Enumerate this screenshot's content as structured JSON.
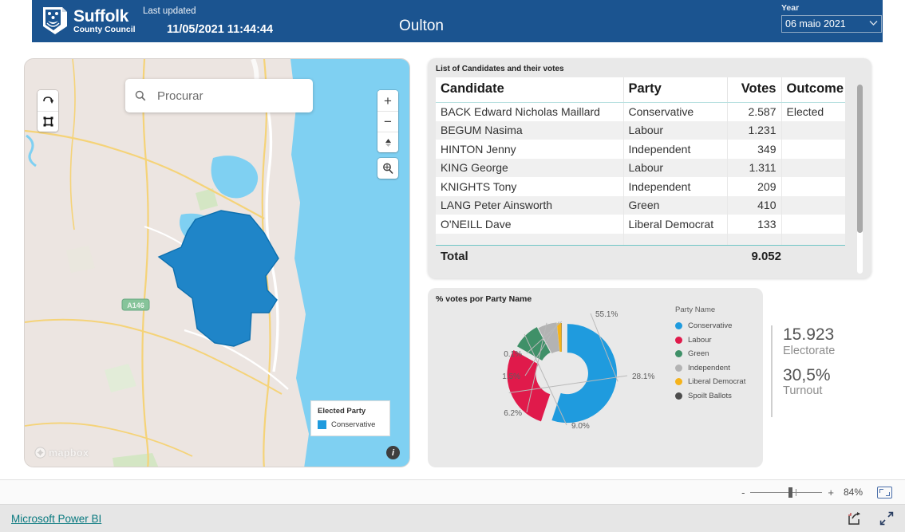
{
  "header": {
    "logo": {
      "icon": "suffolk-crest-icon",
      "line1": "Suffolk",
      "line2": "County Council"
    },
    "last_updated_label": "Last updated",
    "last_updated_value": "11/05/2021 11:44:44",
    "title": "Oulton",
    "year_label": "Year",
    "year_value": "06 maio 2021",
    "chevron": "⌄",
    "brand_color": "#1b5490"
  },
  "map": {
    "search_placeholder": "Procurar",
    "search_value": "",
    "search_icon": "search-icon",
    "controls": {
      "pan_icon": "pan-reset-icon",
      "select_icon": "box-select-icon",
      "zoom_in": "+",
      "zoom_out": "−",
      "compass_icon": "compass-icon",
      "locate_icon": "magnifier-locate-icon"
    },
    "road_label": "A146",
    "legend": {
      "title": "Elected Party",
      "items": [
        {
          "label": "Conservative",
          "color": "#1f9bde"
        }
      ]
    },
    "attribution": "mapbox",
    "attribution_icon": "mapbox-logo-icon",
    "info_icon": "info-icon",
    "info_glyph": "i",
    "water_color": "#7fd0f2",
    "land_color": "#ece5e1",
    "ward_fill": "#1f85c8"
  },
  "votes_table": {
    "card_title": "List of Candidates and their votes",
    "columns": [
      "Candidate",
      "Party",
      "Votes",
      "Outcome"
    ],
    "rows": [
      {
        "candidate": "BACK Edward Nicholas Maillard",
        "party": "Conservative",
        "votes": "2.587",
        "outcome": "Elected"
      },
      {
        "candidate": "BEGUM Nasima",
        "party": "Labour",
        "votes": "1.231",
        "outcome": ""
      },
      {
        "candidate": "HINTON Jenny",
        "party": "Independent",
        "votes": "349",
        "outcome": ""
      },
      {
        "candidate": "KING George",
        "party": "Labour",
        "votes": "1.311",
        "outcome": ""
      },
      {
        "candidate": "KNIGHTS Tony",
        "party": "Independent",
        "votes": "209",
        "outcome": ""
      },
      {
        "candidate": "LANG Peter Ainsworth",
        "party": "Green",
        "votes": "410",
        "outcome": ""
      },
      {
        "candidate": "O'NEILL Dave",
        "party": "Liberal Democrat",
        "votes": "133",
        "outcome": ""
      }
    ],
    "total_label": "Total",
    "total_value": "9.052"
  },
  "chart_data": {
    "type": "pie",
    "title": "% votes por Party Name",
    "xlabel": "",
    "ylabel": "",
    "legend_title": "Party Name",
    "legend_position": "right",
    "categories": [
      "Conservative",
      "Labour",
      "Green",
      "Independent",
      "Liberal Democrat",
      "Spoilt Ballots"
    ],
    "values": [
      55.1,
      28.1,
      9.0,
      6.2,
      1.5,
      0.1
    ],
    "labels": [
      "55.1%",
      "28.1%",
      "9.0%",
      "6.2%",
      "1.5%",
      "0.1%"
    ],
    "colors": [
      "#1f9bde",
      "#e01a4b",
      "#3f9068",
      "#b3b3b3",
      "#f5b31b",
      "#4d4d4d"
    ],
    "hole_ratio": 0.42
  },
  "kpis": [
    {
      "value": "15.923",
      "label": "Electorate"
    },
    {
      "value": "30,5%",
      "label": "Turnout"
    }
  ],
  "bottom_bar": {
    "minus": "-",
    "plus": "+",
    "zoom_percent": "84%",
    "fit_icon": "fit-to-page-icon"
  },
  "footer": {
    "link_text": "Microsoft Power BI",
    "link_color": "#08797f",
    "share_icon": "share-icon",
    "fullscreen_icon": "fullscreen-icon"
  }
}
